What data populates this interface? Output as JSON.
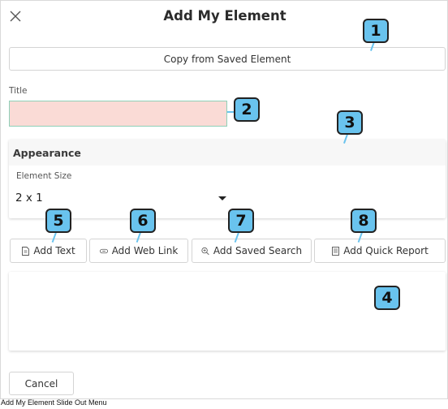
{
  "dialog": {
    "title": "Add My Element",
    "copy_button": "Copy from Saved Element",
    "title_field": {
      "label": "Title",
      "value": ""
    },
    "appearance": {
      "header": "Appearance",
      "size_label": "Element Size",
      "size_value": "2 x 1"
    },
    "add_buttons": {
      "text": "Add Text",
      "web_link": "Add Web Link",
      "saved_search": "Add Saved Search",
      "quick_report": "Add Quick Report"
    },
    "cancel_button": "Cancel"
  },
  "callouts": [
    "1",
    "2",
    "3",
    "4",
    "5",
    "6",
    "7",
    "8"
  ],
  "caption": "Add My Element Slide Out Menu",
  "colors": {
    "callout_fill": "#69c3ee",
    "title_field_error_bg": "#fadbd6",
    "title_field_border": "#8fd0b8"
  },
  "icons": {
    "close": "close-icon",
    "dropdown": "caret-down-icon",
    "text": "document-icon",
    "web_link": "link-icon",
    "saved_search": "magnifier-plus-icon",
    "quick_report": "report-icon"
  }
}
